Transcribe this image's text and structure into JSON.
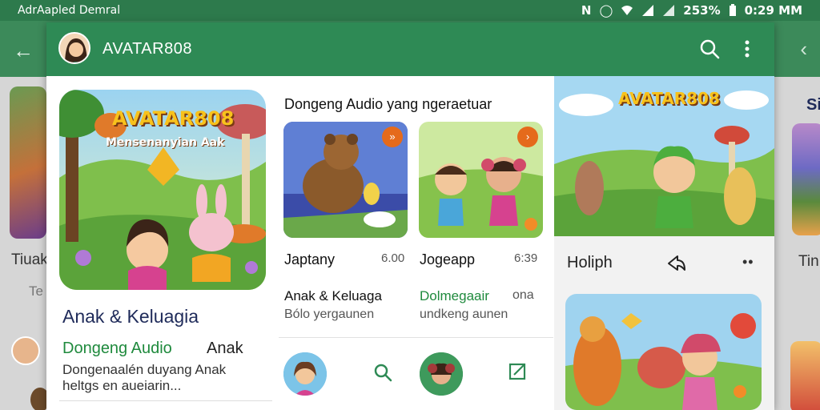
{
  "status_bar": {
    "carrier": "AdrAapled Demral",
    "battery": "253%",
    "time": "0:29 MM"
  },
  "background": {
    "left_card_title": "Tiuak",
    "left_card_sub": "Te",
    "right_card_title": "Tinn",
    "right_card_title2": "Si"
  },
  "dialog": {
    "title": "AVATAR808",
    "featured": {
      "art_title": "AVATAR808",
      "art_subtitle": "Mensenanyian Aak",
      "title": "Anak & Keluagia",
      "category": "Dongeng Audio",
      "category_right": "Anak",
      "description": "Dongenaalén duyang Anak heltgs en aueiarin..."
    },
    "section_title": "Dongeng Audio yang ngeraetuar",
    "tiles": [
      {
        "name": "Japtany",
        "meta": "6.00",
        "caption": "Anak & Keluaga",
        "caption_sub": "Bólo yergaunen",
        "badge": "»"
      },
      {
        "name": "Jogeapp",
        "meta": "6:39",
        "caption": "Dolmegaair",
        "caption_mid": "ona",
        "caption_sub": "undkeng aunen",
        "badge": "›"
      }
    ],
    "right_pane": {
      "hero_title": "AVATAR808",
      "title": "Holiph",
      "more": "••"
    }
  },
  "colors": {
    "status_bar": "#2d7a4c",
    "header": "#2e8a55",
    "category_green": "#1f8a3d",
    "title_navy": "#1f2b5a",
    "badge_orange": "#e56a1b"
  }
}
